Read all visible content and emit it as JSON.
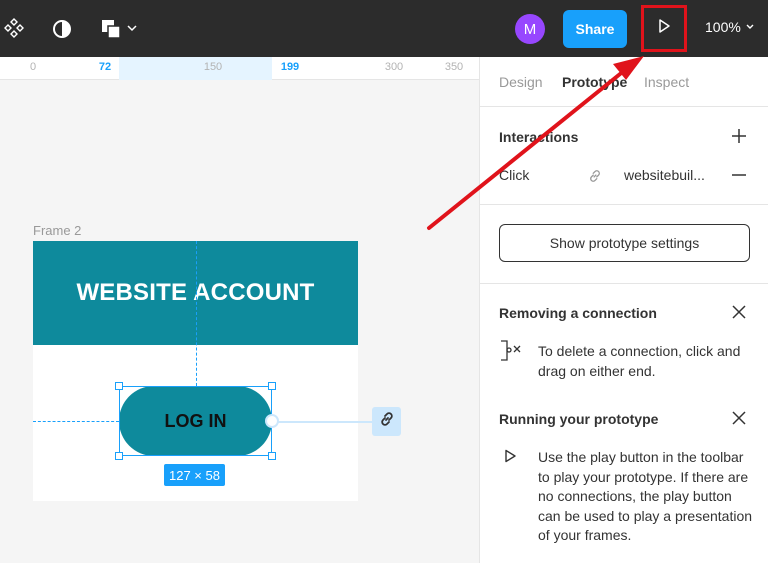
{
  "toolbar": {
    "avatar_initial": "M",
    "share_label": "Share",
    "zoom_label": "100%",
    "accent_color": "#18a0fb",
    "avatar_color": "#9747ff",
    "highlight_color": "#e0131b",
    "icons": [
      "components-icon",
      "contrast-icon",
      "shapes-icon",
      "chevron-down-icon",
      "play-icon",
      "chevron-down-icon"
    ]
  },
  "ruler": {
    "ticks": [
      {
        "label": "0",
        "selected": false
      },
      {
        "label": "72",
        "selected": true
      },
      {
        "label": "150",
        "selected": false
      },
      {
        "label": "199",
        "selected": true
      },
      {
        "label": "300",
        "selected": false
      },
      {
        "label": "350",
        "selected": false
      }
    ]
  },
  "canvas": {
    "frame_label": "Frame 2",
    "frame_title": "WEBSITE ACCOUNT",
    "button_label": "LOG IN",
    "size_badge": "127 × 58",
    "brand_color": "#0e8a9c"
  },
  "panel": {
    "tabs": [
      {
        "label": "Design",
        "active": false
      },
      {
        "label": "Prototype",
        "active": true
      },
      {
        "label": "Inspect",
        "active": false
      }
    ],
    "interactions_title": "Interactions",
    "interaction": {
      "trigger": "Click",
      "destination": "websitebuil..."
    },
    "settings_button": "Show prototype settings",
    "removing": {
      "title": "Removing a connection",
      "text": "To delete a connection, click and drag on either end."
    },
    "running": {
      "title": "Running your prototype",
      "text": "Use the play button in the toolbar to play your prototype. If there are no connections, the play button can be used to play a presentation of your frames."
    }
  }
}
